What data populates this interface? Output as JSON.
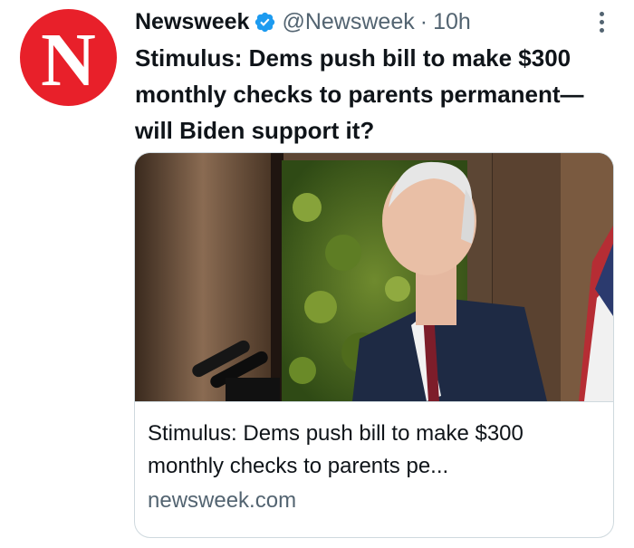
{
  "account": {
    "name": "Newsweek",
    "handle": "@Newsweek",
    "separator": "·",
    "time": "10h",
    "avatar_letter": "N",
    "avatar_color": "#e8202a",
    "verified_color": "#1d9bf0"
  },
  "tweet": {
    "text": "Stimulus: Dems push bill to make $300 monthly checks to parents permanent—will Biden support it?"
  },
  "card": {
    "title": "Stimulus: Dems push bill to make $300 monthly checks to parents pe...",
    "domain": "newsweek.com"
  }
}
